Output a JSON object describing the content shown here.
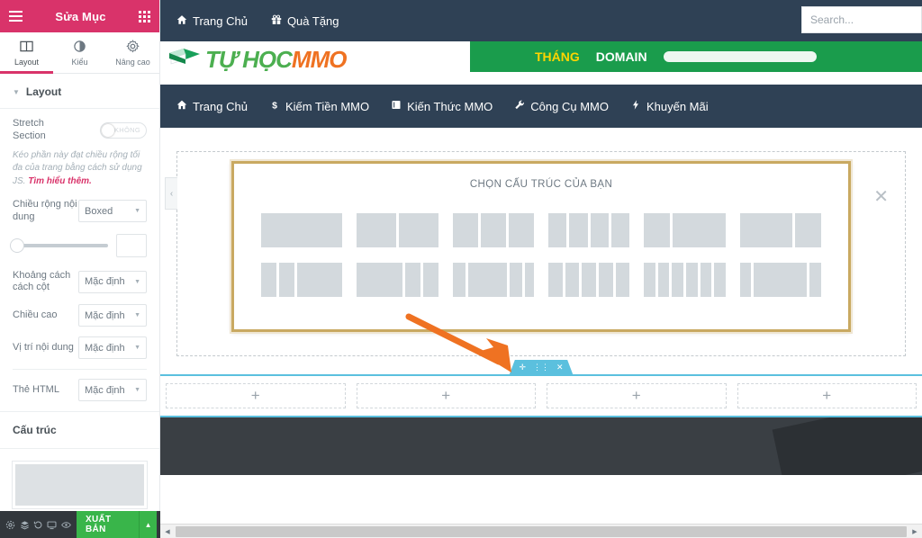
{
  "panel": {
    "title": "Sửa Mục",
    "menu_icon": "hamburger-icon",
    "apps_icon": "grid-icon",
    "tabs": [
      {
        "label": "Layout",
        "icon": "columns-icon",
        "active": true
      },
      {
        "label": "Kiểu",
        "icon": "contrast-icon",
        "active": false
      },
      {
        "label": "Nâng cao",
        "icon": "gear-icon",
        "active": false
      }
    ],
    "layout_section": {
      "heading": "Layout",
      "caret": "▼",
      "stretch_label": "Stretch Section",
      "stretch_value": "KHÔNG",
      "help_text": "Kéo phần này đạt chiều rộng tối đa của trang bằng cách sử dụng JS.",
      "help_link": "Tìm hiểu thêm.",
      "controls": [
        {
          "label": "Chiều rộng nội dung",
          "value": "Boxed"
        },
        {
          "label": "Khoảng cách cách cột",
          "value": "Mặc định"
        },
        {
          "label": "Chiều cao",
          "value": "Mặc định"
        },
        {
          "label": "Vị trí nội dung",
          "value": "Mặc định"
        },
        {
          "label": "Thẻ HTML",
          "value": "Mặc định"
        }
      ],
      "slider_value": ""
    },
    "structure_section": {
      "heading": "Cấu trúc"
    },
    "bottom_bar": {
      "icons": [
        "gear-icon",
        "layers-icon",
        "history-icon",
        "monitor-icon",
        "eye-icon"
      ],
      "publish_label": "XUẤT BẢN",
      "publish_arrow": "▲",
      "publish_color": "#39b54a"
    }
  },
  "site": {
    "topbar": [
      {
        "label": "Trang Chủ",
        "icon": "home-icon"
      },
      {
        "label": "Quà Tặng",
        "icon": "gift-icon"
      }
    ],
    "search": {
      "placeholder": "Search...",
      "value": ""
    },
    "logo": {
      "part1": "TỰ HỌC",
      "part2": "MMO",
      "icon": "book-icon"
    },
    "promo_banner": {
      "text1": "THÁNG",
      "text2": "DOMAIN",
      "color": "#1a9c4c"
    },
    "mainnav": [
      {
        "label": "Trang Chủ",
        "icon": "home-icon"
      },
      {
        "label": "Kiếm Tiền MMO",
        "icon": "dollar-icon"
      },
      {
        "label": "Kiến Thức MMO",
        "icon": "book-icon"
      },
      {
        "label": "Công Cụ MMO",
        "icon": "wrench-icon"
      },
      {
        "label": "Khuyến Mãi",
        "icon": "bolt-icon"
      }
    ]
  },
  "structure_dialog": {
    "title": "CHỌN CẤU TRÚC CỦA BẠN",
    "close_icon": "close-icon",
    "border_color": "#c9a961",
    "presets": [
      {
        "name": "1-column",
        "cols": [
          100
        ]
      },
      {
        "name": "2-columns-equal",
        "cols": [
          50,
          50
        ]
      },
      {
        "name": "3-columns-equal",
        "cols": [
          33,
          33,
          33
        ]
      },
      {
        "name": "4-columns-equal",
        "cols": [
          25,
          25,
          25,
          25
        ]
      },
      {
        "name": "one-third-two-thirds",
        "cols": [
          33,
          67
        ]
      },
      {
        "name": "two-thirds-one-third",
        "cols": [
          67,
          33
        ]
      },
      {
        "name": "narrow-narrow-wide",
        "cols": [
          20,
          20,
          60
        ]
      },
      {
        "name": "wide-narrow-narrow",
        "cols": [
          60,
          20,
          20
        ]
      },
      {
        "name": "narrow-wide-narrow-small",
        "cols": [
          18,
          52,
          18,
          12
        ]
      },
      {
        "name": "five-columns-equal",
        "cols": [
          20,
          20,
          20,
          20,
          20
        ]
      },
      {
        "name": "six-columns-equal",
        "cols": [
          16,
          16,
          16,
          16,
          16,
          16
        ]
      },
      {
        "name": "narrow-wide-narrow",
        "cols": [
          15,
          70,
          15
        ]
      }
    ]
  },
  "collapse_tab": {
    "icon": "chevron-left-icon"
  },
  "annotation": {
    "type": "arrow",
    "color": "#ef7222"
  },
  "section_toolbar": {
    "add_icon": "plus-icon",
    "drag_icon": "grip-icon",
    "close_icon": "close-icon",
    "color": "#5bc0de"
  },
  "new_section": {
    "columns": [
      {
        "label": "+"
      },
      {
        "label": "+"
      },
      {
        "label": "+"
      },
      {
        "label": "+"
      }
    ]
  },
  "scrollbar": {
    "left_arrow": "◀",
    "right_arrow": "▶"
  }
}
